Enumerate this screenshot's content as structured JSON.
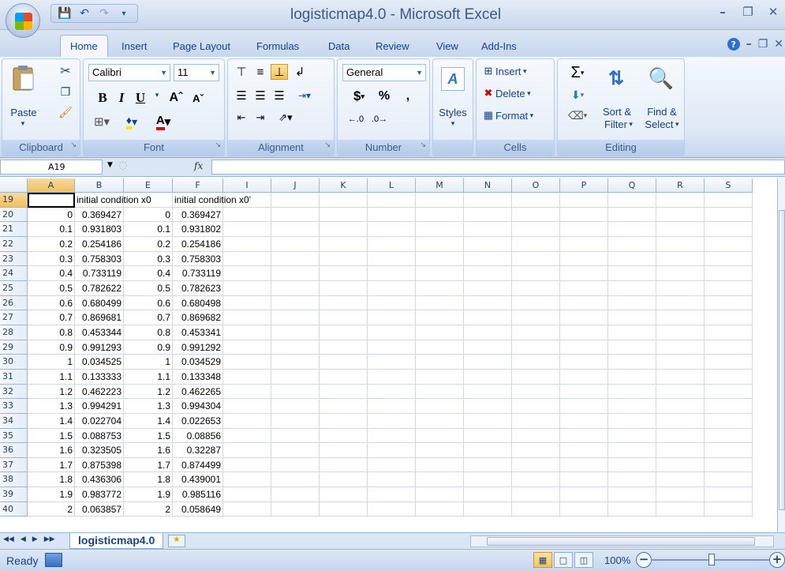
{
  "title": "logisticmap4.0 - Microsoft Excel",
  "tabs": [
    "Home",
    "Insert",
    "Page Layout",
    "Formulas",
    "Data",
    "Review",
    "View",
    "Add-Ins"
  ],
  "active_tab": "Home",
  "ribbon": {
    "clipboard": {
      "label": "Clipboard",
      "paste": "Paste"
    },
    "font": {
      "label": "Font",
      "name": "Calibri",
      "size": "11",
      "bold": "B",
      "italic": "I",
      "underline": "U"
    },
    "alignment": {
      "label": "Alignment"
    },
    "number": {
      "label": "Number",
      "format": "General",
      "currency": "$",
      "percent": "%",
      "comma": ","
    },
    "styles": {
      "label": "Styles"
    },
    "cells": {
      "label": "Cells",
      "insert": "Insert",
      "delete": "Delete",
      "format": "Format"
    },
    "editing": {
      "label": "Editing",
      "sort": "Sort &",
      "filter": "Filter",
      "find": "Find &",
      "select": "Select"
    }
  },
  "formula_bar": {
    "name_box": "A19",
    "fx": "fx",
    "value": ""
  },
  "columns": [
    "A",
    "B",
    "E",
    "F",
    "I",
    "J",
    "K",
    "L",
    "M",
    "N",
    "O",
    "P",
    "Q",
    "R",
    "S"
  ],
  "selected_column": "A",
  "selected_row": "19",
  "rows": [
    {
      "n": "19",
      "A": "",
      "B": "initial condition x0",
      "E": "",
      "F": "initial condition x0'"
    },
    {
      "n": "20",
      "A": "0",
      "B": "0.369427",
      "E": "0",
      "F": "0.369427"
    },
    {
      "n": "21",
      "A": "0.1",
      "B": "0.931803",
      "E": "0.1",
      "F": "0.931802"
    },
    {
      "n": "22",
      "A": "0.2",
      "B": "0.254186",
      "E": "0.2",
      "F": "0.254186"
    },
    {
      "n": "23",
      "A": "0.3",
      "B": "0.758303",
      "E": "0.3",
      "F": "0.758303"
    },
    {
      "n": "24",
      "A": "0.4",
      "B": "0.733119",
      "E": "0.4",
      "F": "0.733119"
    },
    {
      "n": "25",
      "A": "0.5",
      "B": "0.782622",
      "E": "0.5",
      "F": "0.782623"
    },
    {
      "n": "26",
      "A": "0.6",
      "B": "0.680499",
      "E": "0.6",
      "F": "0.680498"
    },
    {
      "n": "27",
      "A": "0.7",
      "B": "0.869681",
      "E": "0.7",
      "F": "0.869682"
    },
    {
      "n": "28",
      "A": "0.8",
      "B": "0.453344",
      "E": "0.8",
      "F": "0.453341"
    },
    {
      "n": "29",
      "A": "0.9",
      "B": "0.991293",
      "E": "0.9",
      "F": "0.991292"
    },
    {
      "n": "30",
      "A": "1",
      "B": "0.034525",
      "E": "1",
      "F": "0.034529"
    },
    {
      "n": "31",
      "A": "1.1",
      "B": "0.133333",
      "E": "1.1",
      "F": "0.133348"
    },
    {
      "n": "32",
      "A": "1.2",
      "B": "0.462223",
      "E": "1.2",
      "F": "0.462265"
    },
    {
      "n": "33",
      "A": "1.3",
      "B": "0.994291",
      "E": "1.3",
      "F": "0.994304"
    },
    {
      "n": "34",
      "A": "1.4",
      "B": "0.022704",
      "E": "1.4",
      "F": "0.022653"
    },
    {
      "n": "35",
      "A": "1.5",
      "B": "0.088753",
      "E": "1.5",
      "F": "0.08856"
    },
    {
      "n": "36",
      "A": "1.6",
      "B": "0.323505",
      "E": "1.6",
      "F": "0.32287"
    },
    {
      "n": "37",
      "A": "1.7",
      "B": "0.875398",
      "E": "1.7",
      "F": "0.874499"
    },
    {
      "n": "38",
      "A": "1.8",
      "B": "0.436306",
      "E": "1.8",
      "F": "0.439001"
    },
    {
      "n": "39",
      "A": "1.9",
      "B": "0.983772",
      "E": "1.9",
      "F": "0.985116"
    },
    {
      "n": "40",
      "A": "2",
      "B": "0.063857",
      "E": "2",
      "F": "0.058649"
    }
  ],
  "sheet_tab": "logisticmap4.0",
  "status": {
    "text": "Ready",
    "zoom": "100%"
  },
  "colors": {
    "accent": "#15428b",
    "ribbon_bg": "#dbe6f4",
    "selected_header": "#f1c15f"
  }
}
